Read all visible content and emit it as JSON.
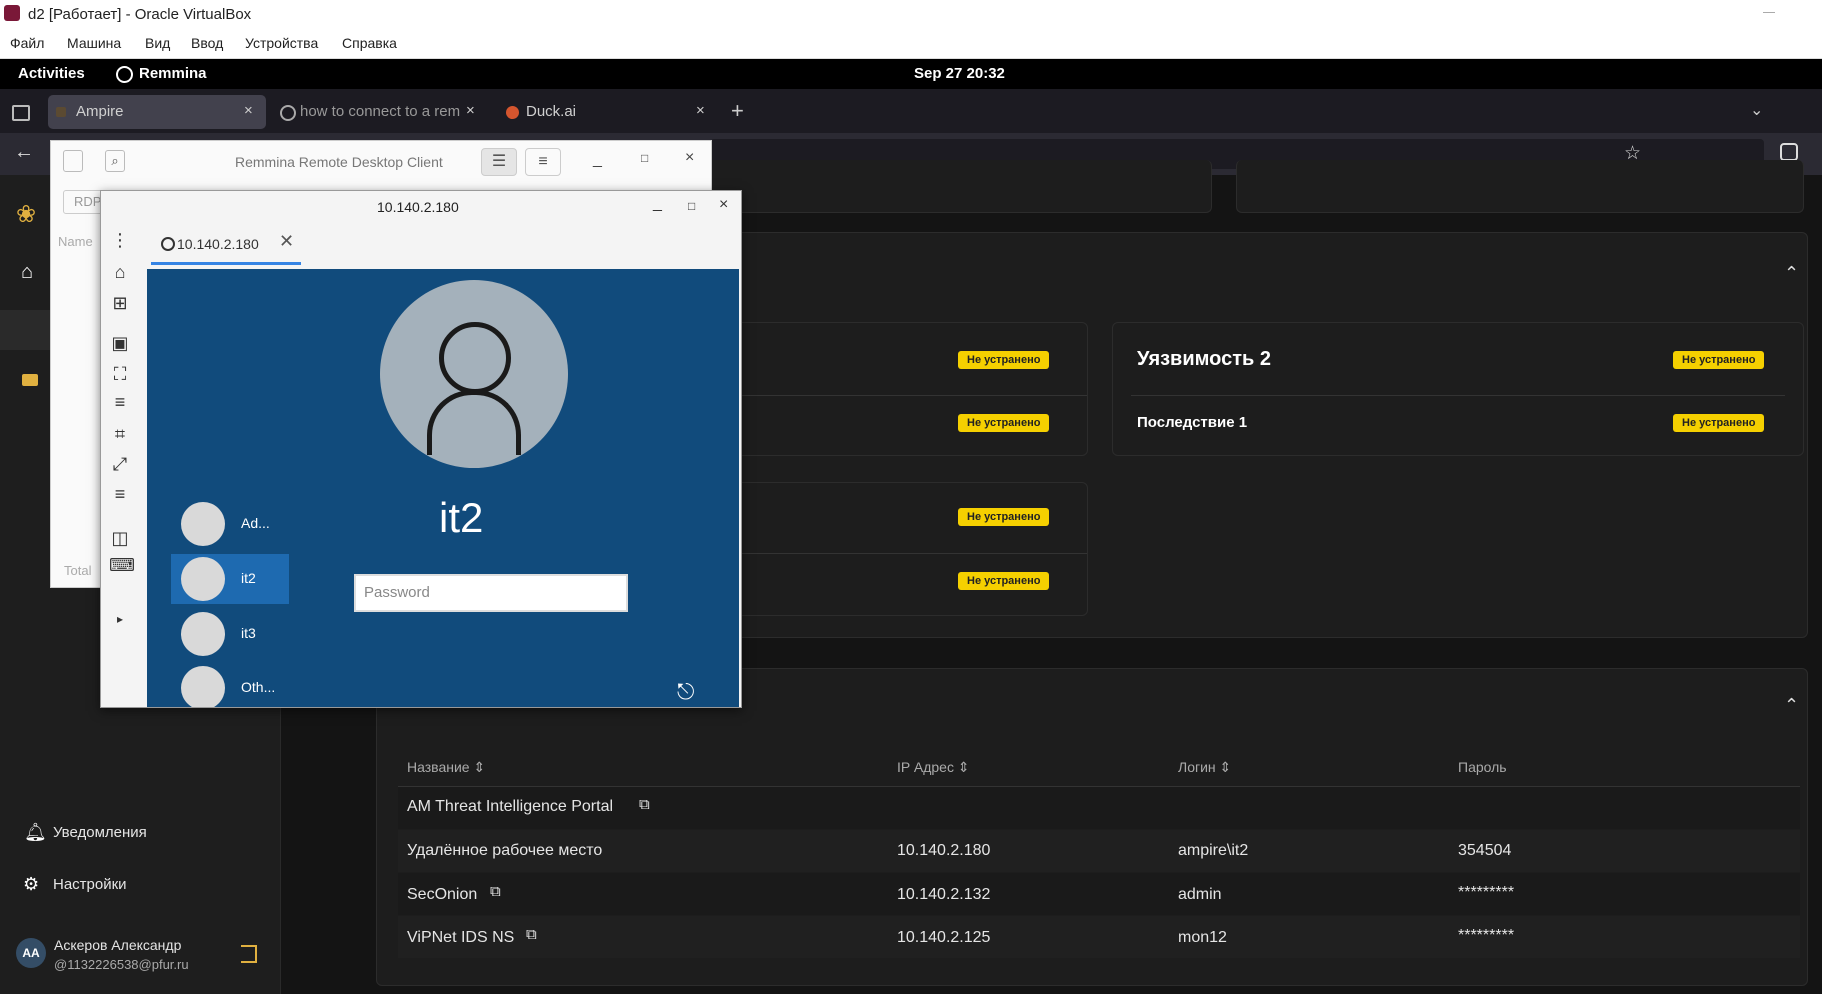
{
  "vbox": {
    "title": "d2 [Работает] - Oracle VirtualBox",
    "menu": [
      "Файл",
      "Машина",
      "Вид",
      "Ввод",
      "Устройства",
      "Справка"
    ]
  },
  "gnome": {
    "activities": "Activities",
    "app": "Remmina",
    "clock": "Sep 27  20:32"
  },
  "browser": {
    "tabs": [
      {
        "label": "Ampire"
      },
      {
        "label": "how to connect to a remo"
      },
      {
        "label": "Duck.ai"
      }
    ]
  },
  "sidebar": {
    "notifications": "Уведомления",
    "settings": "Настройки",
    "user_initials": "AA",
    "user_name": "Аскеров Александр",
    "user_email": "@1132226538@pfur.ru"
  },
  "vulns": {
    "status": "Не устранено",
    "card2_title": "Уязвимость 2",
    "card2_row": "Последствие 1"
  },
  "resources": {
    "columns": [
      "Название ⇕",
      "IP Адрес ⇕",
      "Логин ⇕",
      "Пароль"
    ],
    "rows": [
      {
        "name": "AM Threat Intelligence Portal",
        "ip": "",
        "login": "",
        "password": ""
      },
      {
        "name": "Удалённое рабочее место",
        "ip": "10.140.2.180",
        "login": "ampire\\it2",
        "password": "354504"
      },
      {
        "name": "SecOnion",
        "ip": "10.140.2.132",
        "login": "admin",
        "password": "*********"
      },
      {
        "name": "ViPNet IDS NS",
        "ip": "10.140.2.125",
        "login": "mon12",
        "password": "*********"
      }
    ]
  },
  "remmina": {
    "main_title": "Remmina Remote Desktop Client",
    "protocol": "RDP",
    "name_col": "Name",
    "total": "Total",
    "conn_title": "10.140.2.180",
    "tab_label": "10.140.2.180",
    "login_user": "it2",
    "password_placeholder": "Password",
    "users": [
      "Ad...",
      "it2",
      "it3",
      "Oth..."
    ]
  }
}
